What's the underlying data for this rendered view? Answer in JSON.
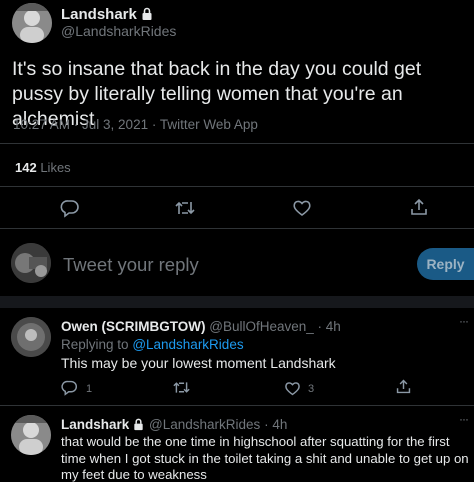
{
  "main_tweet": {
    "author_name": "Landshark",
    "author_handle": "@LandsharkRides",
    "text": "It's so insane that back in the day you could get pussy by literally telling women that you're an alchemist",
    "meta": "10:27 AM · Jul 3, 2021 · Twitter Web App",
    "likes_count": "142",
    "likes_label": "Likes"
  },
  "reply_box": {
    "placeholder": "Tweet your reply",
    "button_label": "Reply"
  },
  "replies": [
    {
      "author_name": "Owen (SCRIMBGTOW)",
      "author_handle": "@BullOfHeaven_",
      "time": "· 4h",
      "replying_to_prefix": "Replying to",
      "replying_to_handle": "@LandsharkRides",
      "text": "This may be your lowest moment Landshark",
      "reply_count": "1",
      "like_count": "3",
      "more": "···"
    },
    {
      "author_name": "Landshark",
      "author_handle": "@LandsharkRides",
      "time": "· 4h",
      "text": "that would be the one time in highschool after squatting for the first time when I got stuck in the toilet taking a shit and unable to get up on my feet due to weakness",
      "more": "···"
    }
  ],
  "colors": {
    "background": "#000000",
    "accent": "#1d9bf0",
    "reply_button": "#1a5a86",
    "text_gray": "#71767b"
  }
}
